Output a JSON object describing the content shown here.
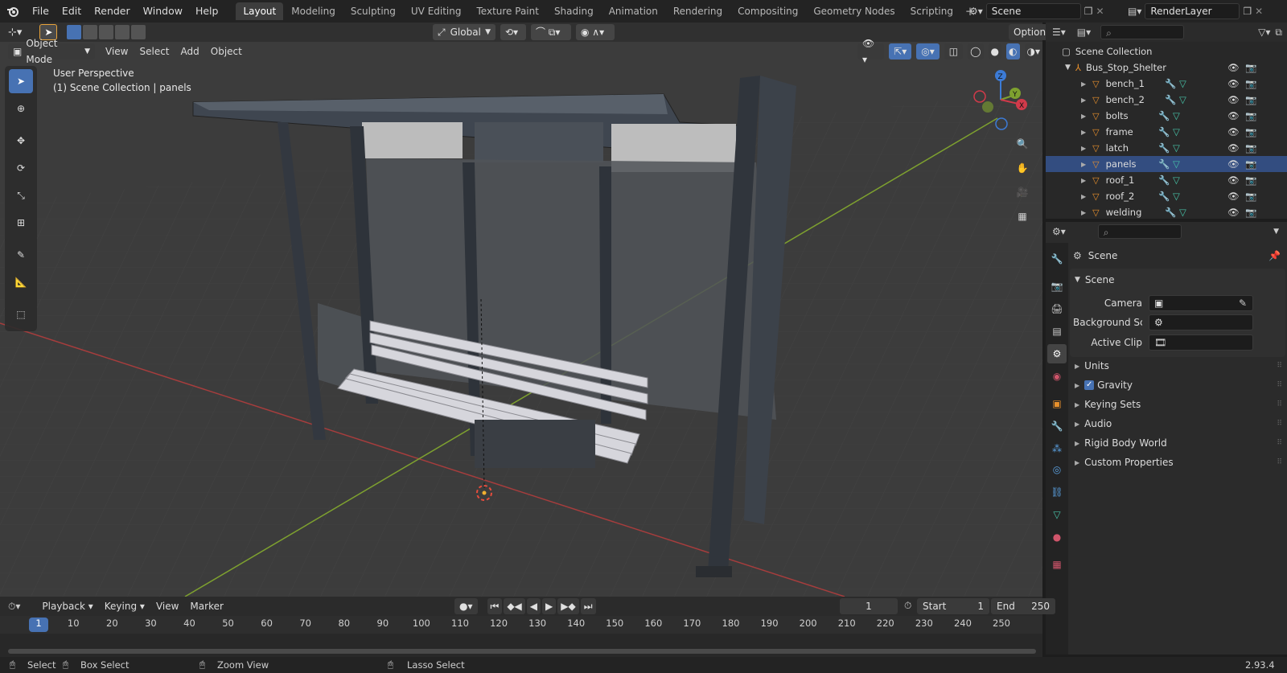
{
  "topbar": {
    "menus": [
      "File",
      "Edit",
      "Render",
      "Window",
      "Help"
    ],
    "workspaces": [
      "Layout",
      "Modeling",
      "Sculpting",
      "UV Editing",
      "Texture Paint",
      "Shading",
      "Animation",
      "Rendering",
      "Compositing",
      "Geometry Nodes",
      "Scripting"
    ],
    "active_workspace": "Layout",
    "scene_name": "Scene",
    "view_layer": "RenderLayer"
  },
  "viewport_header": {
    "transform_orientation": "Global",
    "options_label": "Options",
    "mode": "Object Mode",
    "menus": [
      "View",
      "Select",
      "Add",
      "Object"
    ]
  },
  "viewport": {
    "perspective_label": "User Perspective",
    "collection_label": "(1) Scene Collection | panels",
    "gizmo_axes": {
      "x": "X",
      "y": "Y",
      "z": "Z"
    }
  },
  "outliner": {
    "root": "Scene Collection",
    "parent": "Bus_Stop_Shelter",
    "items": [
      {
        "name": "bench_1",
        "selected": false
      },
      {
        "name": "bench_2",
        "selected": false
      },
      {
        "name": "bolts",
        "selected": false
      },
      {
        "name": "frame",
        "selected": false
      },
      {
        "name": "latch",
        "selected": false
      },
      {
        "name": "panels",
        "selected": true
      },
      {
        "name": "roof_1",
        "selected": false
      },
      {
        "name": "roof_2",
        "selected": false
      },
      {
        "name": "welding",
        "selected": false
      }
    ]
  },
  "properties": {
    "context_title": "Scene",
    "panel_title": "Scene",
    "fields": {
      "camera": "Camera",
      "background_scene": "Background Sce...",
      "active_clip": "Active Clip"
    },
    "subpanels": [
      "Units",
      "Gravity",
      "Keying Sets",
      "Audio",
      "Rigid Body World",
      "Custom Properties"
    ],
    "gravity_checked": true
  },
  "timeline": {
    "menus": [
      "Playback",
      "Keying",
      "View",
      "Marker"
    ],
    "current_frame": "1",
    "start_label": "Start",
    "start": "1",
    "end_label": "End",
    "end": "250",
    "ticks": [
      "1",
      "10",
      "20",
      "30",
      "40",
      "50",
      "60",
      "70",
      "80",
      "90",
      "100",
      "110",
      "120",
      "130",
      "140",
      "150",
      "160",
      "170",
      "180",
      "190",
      "200",
      "210",
      "220",
      "230",
      "240",
      "250"
    ]
  },
  "statusbar": {
    "select": "Select",
    "box_select": "Box Select",
    "zoom_view": "Zoom View",
    "lasso_select": "Lasso Select",
    "version": "2.93.4"
  },
  "colors": {
    "accent": "#4772b3",
    "x_axis": "#a63d3d",
    "y_axis": "#7ea12f",
    "object_icon": "#e8902c",
    "mesh_icon": "#47c2a7"
  }
}
